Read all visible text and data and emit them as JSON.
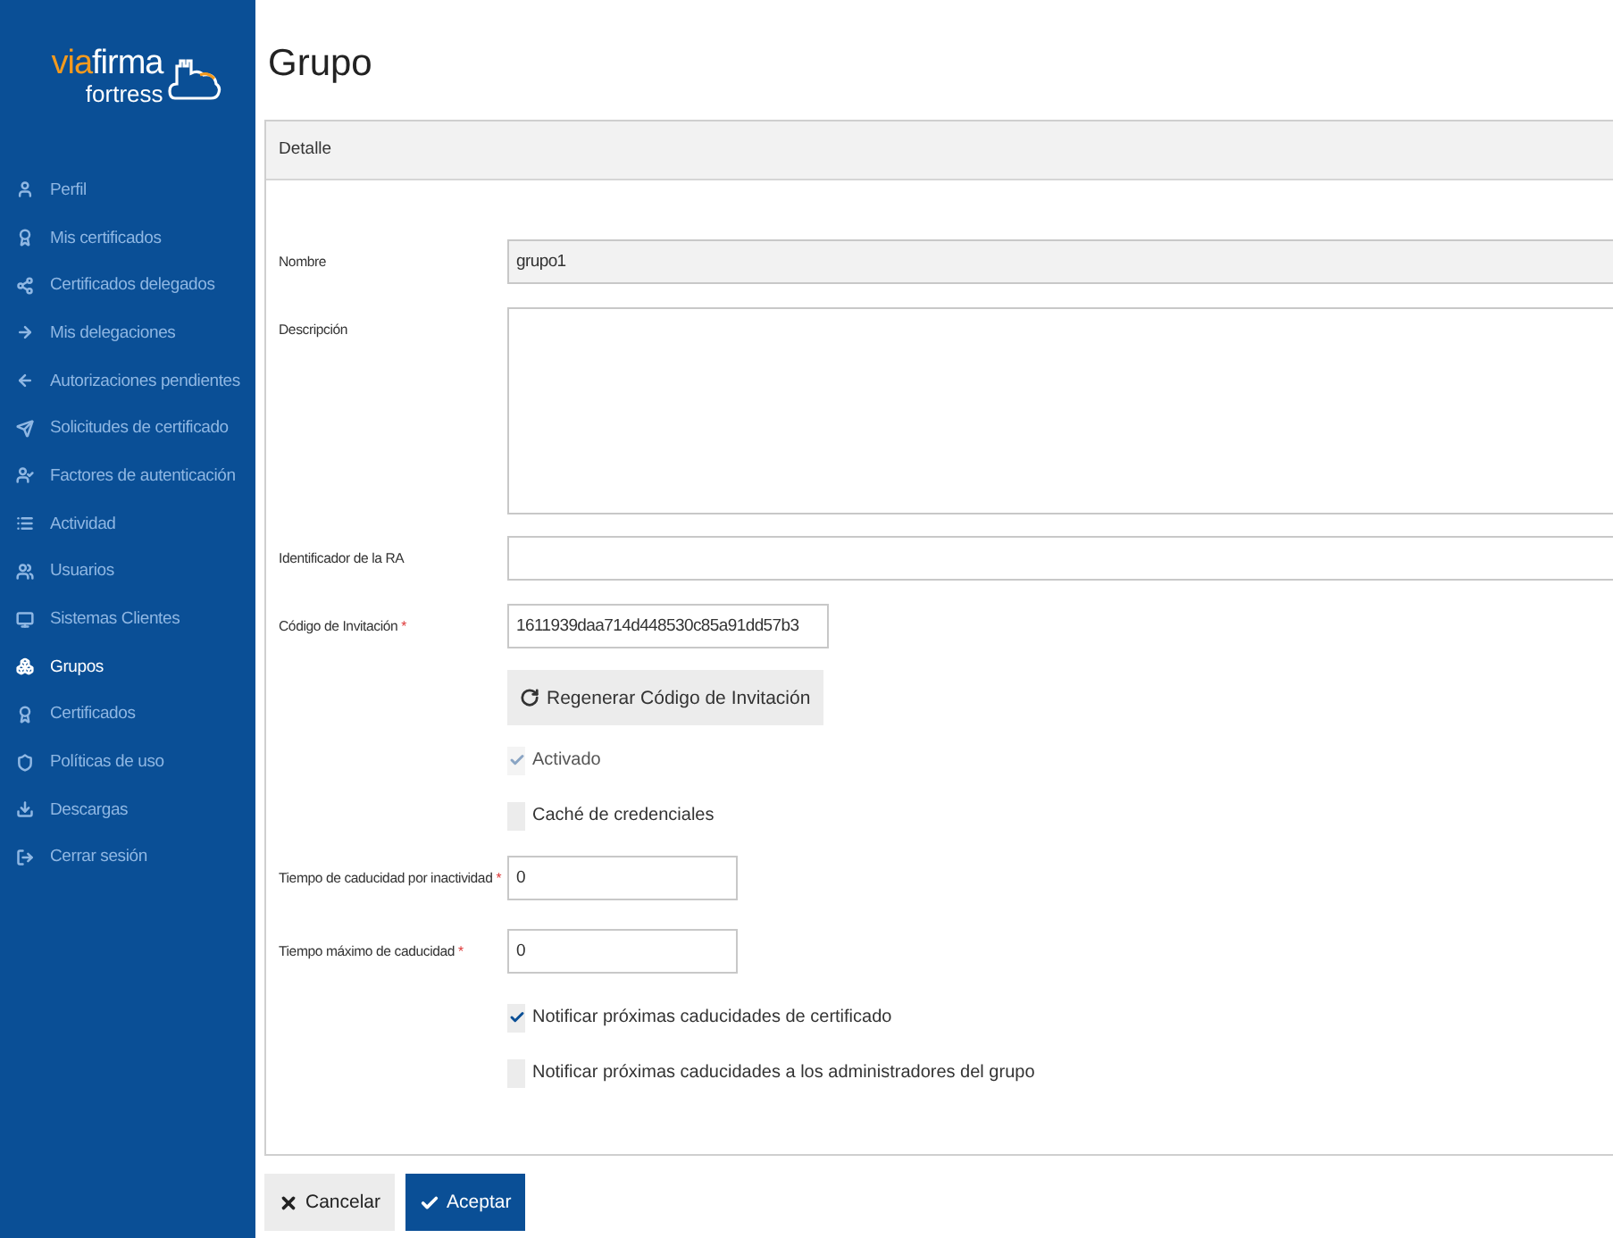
{
  "sidebar": {
    "logo": {
      "prefix": "via",
      "name": "firma",
      "subtitle": "fortress"
    },
    "items": [
      {
        "label": "Perfil",
        "selected": false
      },
      {
        "label": "Mis certificados",
        "selected": false
      },
      {
        "label": "Certificados delegados",
        "selected": false
      },
      {
        "label": "Mis delegaciones",
        "selected": false
      },
      {
        "label": "Autorizaciones pendientes",
        "selected": false
      },
      {
        "label": "Solicitudes de certificado",
        "selected": false
      },
      {
        "label": "Factores de autenticación",
        "selected": false
      },
      {
        "label": "Actividad",
        "selected": false
      },
      {
        "label": "Usuarios",
        "selected": false
      },
      {
        "label": "Sistemas Clientes",
        "selected": false
      },
      {
        "label": "Grupos",
        "selected": true
      },
      {
        "label": "Certificados",
        "selected": false
      },
      {
        "label": "Políticas de uso",
        "selected": false
      },
      {
        "label": "Descargas",
        "selected": false
      },
      {
        "label": "Cerrar sesión",
        "selected": false
      }
    ]
  },
  "page": {
    "title": "Grupo"
  },
  "panel": {
    "header": "Detalle",
    "fields": [
      {
        "kind": "text",
        "label": "Nombre",
        "value": "grupo1",
        "disabled": true
      },
      {
        "kind": "textarea",
        "label": "Descripción"
      },
      {
        "kind": "text",
        "label": "Identificador de la RA",
        "disabled": false
      },
      {
        "kind": "code",
        "label": "Código de Invitación",
        "required_mark": "*",
        "value": "1611939daa714d448530c85a91dd57b3"
      },
      {
        "kind": "button",
        "label": "Regenerar Código de Invitación"
      },
      {
        "kind": "checkbox",
        "label": "Activado",
        "checked": true,
        "disabled": true
      },
      {
        "kind": "checkbox",
        "label": "Caché de credenciales",
        "checked": false
      },
      {
        "kind": "number",
        "label": "Tiempo de caducidad por inactividad",
        "required_mark": "*",
        "value": "0"
      },
      {
        "kind": "number",
        "label": "Tiempo máximo de caducidad",
        "required_mark": "*",
        "value": "0"
      },
      {
        "kind": "checkbox",
        "label": "Notificar próximas caducidades de certificado",
        "checked": true,
        "disabled": false
      },
      {
        "kind": "checkbox",
        "label": "Notificar próximas caducidades a los administradores del grupo",
        "checked": false
      }
    ]
  },
  "actions": [
    {
      "kind": "cancel",
      "label": "Cancelar"
    },
    {
      "kind": "accept",
      "label": "Aceptar"
    }
  ]
}
